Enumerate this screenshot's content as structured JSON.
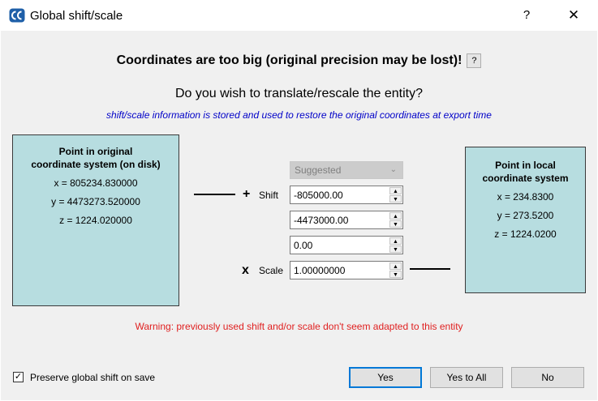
{
  "window": {
    "title": "Global shift/scale",
    "help_glyph": "?",
    "close_glyph": "✕"
  },
  "header": {
    "headline": "Coordinates are too big (original precision may be lost)!",
    "help_label": "?",
    "question": "Do you wish to translate/rescale the entity?",
    "info": "shift/scale information is stored and used to restore the original coordinates at export time"
  },
  "original": {
    "title_line1": "Point in original",
    "title_line2": "coordinate system (on disk)",
    "x": "x = 805234.830000",
    "y": "y = 4473273.520000",
    "z": "z = 1224.020000"
  },
  "local": {
    "title_line1": "Point in local",
    "title_line2": "coordinate system",
    "x": "x = 234.8300",
    "y": "y = 273.5200",
    "z": "z = 1224.0200"
  },
  "controls": {
    "preset_value": "Suggested",
    "plus_symbol": "+",
    "shift_label": "Shift",
    "shift_x": "-805000.00",
    "shift_y": "-4473000.00",
    "shift_z": "0.00",
    "times_symbol": "x",
    "scale_label": "Scale",
    "scale_value": "1.00000000"
  },
  "warning": "Warning: previously used shift and/or scale don't seem adapted to this entity",
  "footer": {
    "preserve_checked": true,
    "preserve_label": "Preserve global shift on save",
    "yes_label": "Yes",
    "yes_to_all_label": "Yes to All",
    "no_label": "No"
  },
  "colors": {
    "box_bg": "#b7dde0",
    "info_text": "#0000c8",
    "warning_text": "#e02020",
    "default_border": "#0078d7"
  }
}
